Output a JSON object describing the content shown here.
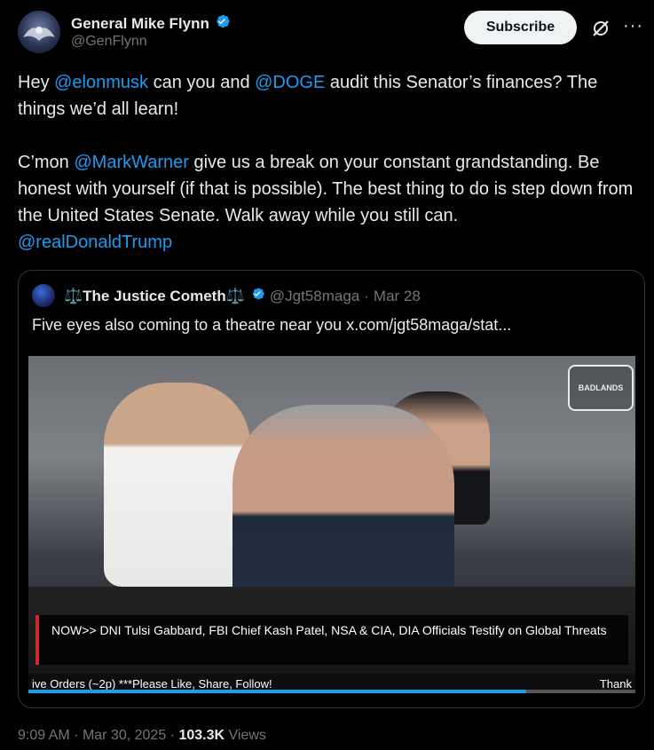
{
  "author": {
    "name": "General Mike Flynn",
    "handle": "@GenFlynn",
    "verified": true,
    "icon": "verified-badge-icon"
  },
  "actions": {
    "subscribe_label": "Subscribe",
    "grok_icon": "grok-icon",
    "more_icon": "more-icon"
  },
  "tweet": {
    "p1_pre": "Hey ",
    "p1_mention1": "@elonmusk",
    "p1_mid": " can you and ",
    "p1_mention2": "@DOGE",
    "p1_post": " audit this Senator’s finances? The things we’d all learn!",
    "p2_pre": "C’mon ",
    "p2_mention": "@MarkWarner",
    "p2_post": " give us a break on your constant grandstanding. Be honest with yourself (if that is possible). The best thing to do is step down from the United States Senate. Walk away while you still can.",
    "p3_mention": "@realDonaldTrump"
  },
  "quote": {
    "name": "⚖️The Justice Cometh⚖️",
    "handle": "@Jgt58maga",
    "separator": "·",
    "date": "Mar 28",
    "text": "Five eyes also coming to a theatre near you  x.com/jgt58maga/stat...",
    "video": {
      "badge_text": "BADLANDS",
      "banner_text": "NOW>> DNI Tulsi Gabbard, FBI Chief Kash Patel, NSA & CIA, DIA Officials Testify on Global Threats",
      "ticker_left": "ive Orders (~2p) ***Please Like, Share, Follow!",
      "ticker_right": "Thank",
      "progress": 0.82
    }
  },
  "meta": {
    "time": "9:09 AM",
    "dot": "·",
    "date": "Mar 30, 2025",
    "views_count": "103.3K",
    "views_label": "Views"
  },
  "colors": {
    "background": "#000000",
    "text": "#e7e9ea",
    "muted": "#71767b",
    "link": "#1d9bf0",
    "border": "#2f3336"
  }
}
